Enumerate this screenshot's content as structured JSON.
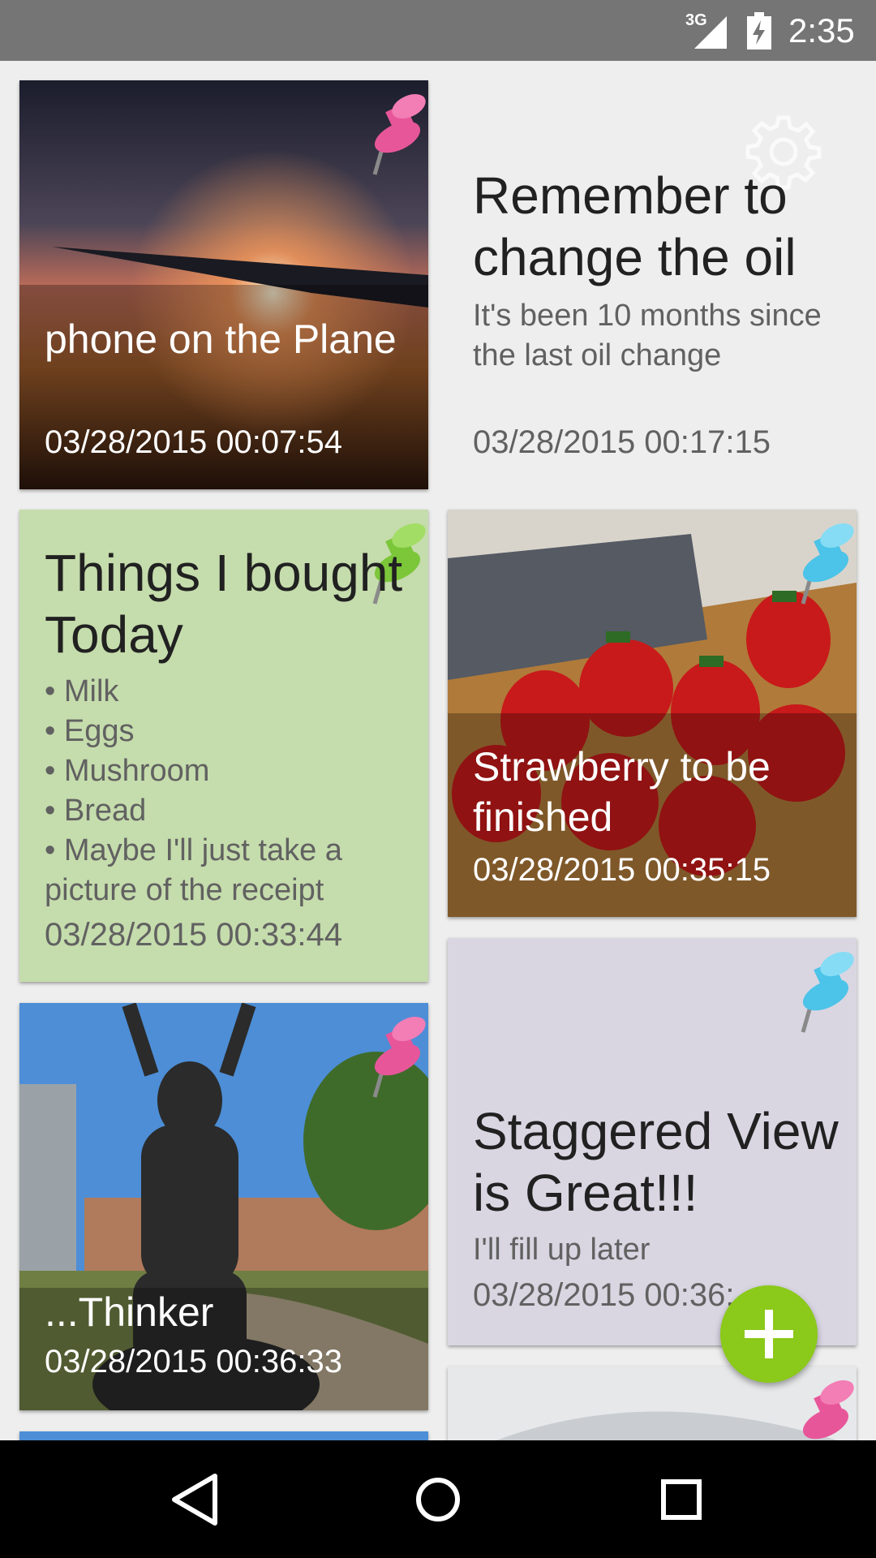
{
  "status_bar": {
    "network": "3G",
    "time": "2:35",
    "icons": [
      "signal-icon",
      "battery-charging-icon"
    ]
  },
  "notes": [
    {
      "title": "phone on the Plane",
      "date": "03/28/2015 00:07:54",
      "pin_color": "#e8569a",
      "type": "photo"
    },
    {
      "title": "Remember to change the oil",
      "body": "It's been 10 months since the last oil change",
      "date": "03/28/2015 00:17:15",
      "type": "text",
      "icon": "gear-icon"
    },
    {
      "title": "Things I bought Today",
      "body": "• Milk\n• Eggs\n• Mushroom\n• Bread\n• Maybe I'll just take a picture of the receipt",
      "date": "03/28/2015 00:33:44",
      "background": "#c5dcac",
      "pin_color": "#7cc63a",
      "type": "text"
    },
    {
      "title": "Strawberry to be finished",
      "date": "03/28/2015 00:35:15",
      "pin_color": "#4cc3e8",
      "type": "photo"
    },
    {
      "title": "...Thinker",
      "date": "03/28/2015 00:36:33",
      "pin_color": "#e8569a",
      "type": "photo"
    },
    {
      "title": "Staggered View is Great!!!",
      "body": "I'll fill up later",
      "date": "03/28/2015 00:36:",
      "background": "#d9d6e2",
      "pin_color": "#4cc3e8",
      "type": "text"
    }
  ],
  "fab": {
    "icon": "add-icon",
    "color": "#8bc91a"
  },
  "nav_bar": {
    "icons": [
      "back-icon",
      "home-icon",
      "recents-icon"
    ]
  }
}
